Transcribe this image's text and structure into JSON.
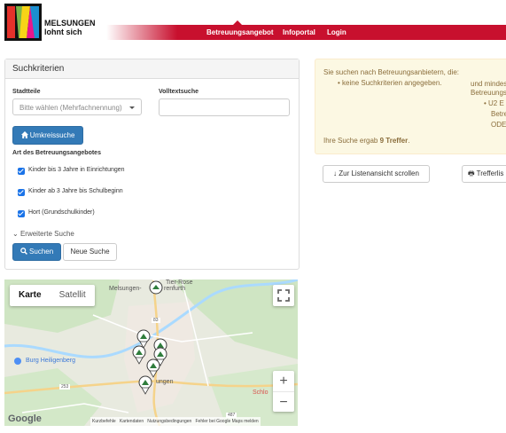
{
  "header": {
    "brand_line1": "MELSUNGEN",
    "brand_line2": "lohnt sich",
    "nav": [
      "Betreuungsangebot",
      "Infoportal",
      "Login"
    ],
    "accent_color": "#c8102e"
  },
  "search": {
    "title": "Suchkriterien",
    "stadtteile_label": "Stadtteile",
    "stadtteile_placeholder": "Bitte wählen (Mehrfachnennung)",
    "volltext_label": "Volltextsuche",
    "volltext_value": "",
    "umkreis_button": "Umkreissuche",
    "art_label": "Art des Betreuungsangebotes",
    "options": [
      {
        "label": "Kinder bis 3 Jahre in Einrichtungen",
        "checked": true
      },
      {
        "label": "Kinder ab 3 Jahre bis Schulbeginn",
        "checked": true
      },
      {
        "label": "Hort (Grundschulkinder)",
        "checked": true
      }
    ],
    "advanced_link": "Erweiterte Suche",
    "search_button": "Suchen",
    "new_search_button": "Neue Suche"
  },
  "info": {
    "line1": "Sie suchen nach Betreuungsanbietern, die:",
    "bullet1": "keine Suchkriterien angegeben.",
    "right1": "und mindes",
    "right2": "Betreuungs",
    "right3": "U2 E",
    "right4": "Betre",
    "right5": "ODE",
    "result_prefix": "Ihre Suche ergab",
    "result_count": "9 Treffer",
    "result_suffix": "."
  },
  "actions": {
    "scroll_button": "Zur Listenansicht scrollen",
    "hits_button": "Trefferlis"
  },
  "map": {
    "tab_map": "Karte",
    "tab_satellite": "Satellit",
    "labels": {
      "melsungen": "Melsungen-",
      "rose": "Tier-Rose",
      "renfurth": "renfurth",
      "heiligenberg": "Burg Heiligenberg",
      "ungen": "ungen",
      "schlo": "Schlo",
      "road83": "83",
      "road253": "253",
      "road487": "487"
    },
    "zoom_in": "+",
    "zoom_out": "−",
    "attribution": [
      "Kurzbefehle",
      "Kartendaten",
      "Nutzungsbedingungen",
      "Fehler bei Google Maps melden"
    ],
    "google": "Google"
  }
}
